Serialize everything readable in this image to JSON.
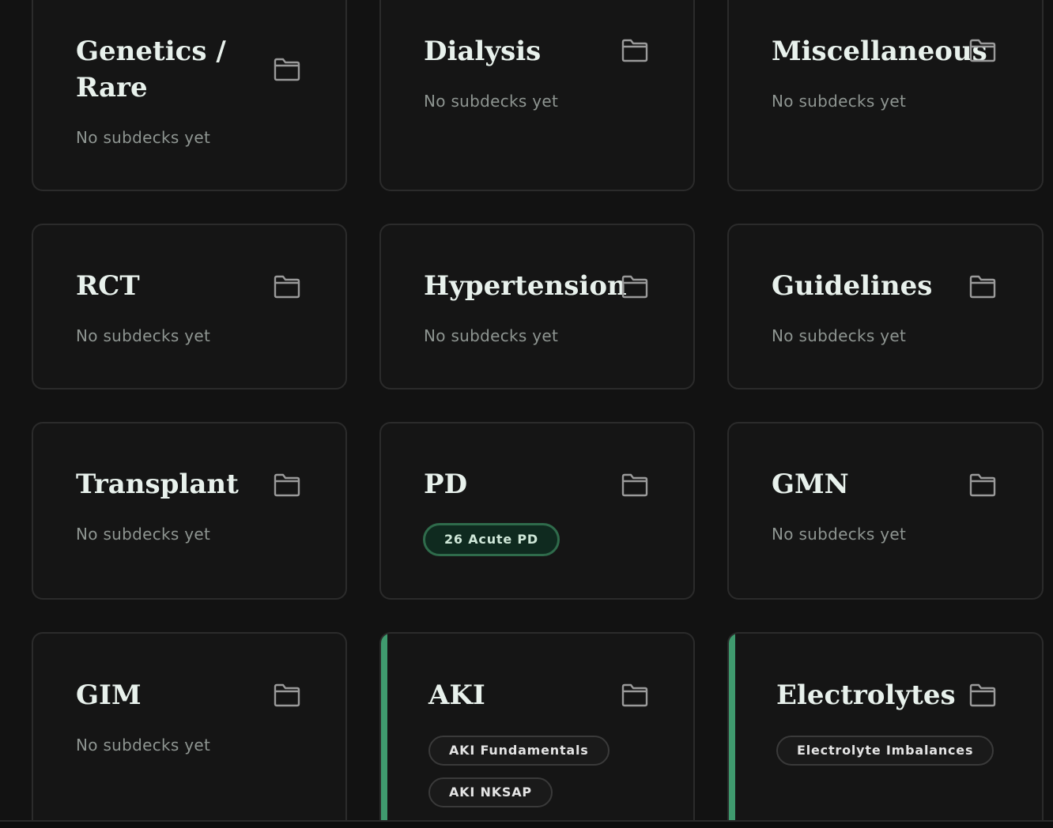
{
  "empty_text": "No subdecks yet",
  "accent_color": "#3f9a6e",
  "cards": {
    "genetics": {
      "title_line1": "Genetics /",
      "title_line2": "Rare"
    },
    "dialysis": {
      "title": "Dialysis"
    },
    "misc": {
      "title": "Miscellaneous"
    },
    "rct": {
      "title": "RCT"
    },
    "hypertension": {
      "title": "Hypertension"
    },
    "guidelines": {
      "title": "Guidelines"
    },
    "transplant": {
      "title": "Transplant"
    },
    "pd": {
      "title": "PD",
      "subdecks": [
        "26 Acute PD"
      ]
    },
    "gmn": {
      "title": "GMN"
    },
    "gim": {
      "title": "GIM"
    },
    "aki": {
      "title": "AKI",
      "subdecks": [
        "AKI Fundamentals",
        "AKI NKSAP"
      ]
    },
    "electrolytes": {
      "title": "Electrolytes",
      "subdecks": [
        "Electrolyte Imbalances"
      ]
    }
  },
  "icons": {
    "folder": "folder-icon"
  }
}
